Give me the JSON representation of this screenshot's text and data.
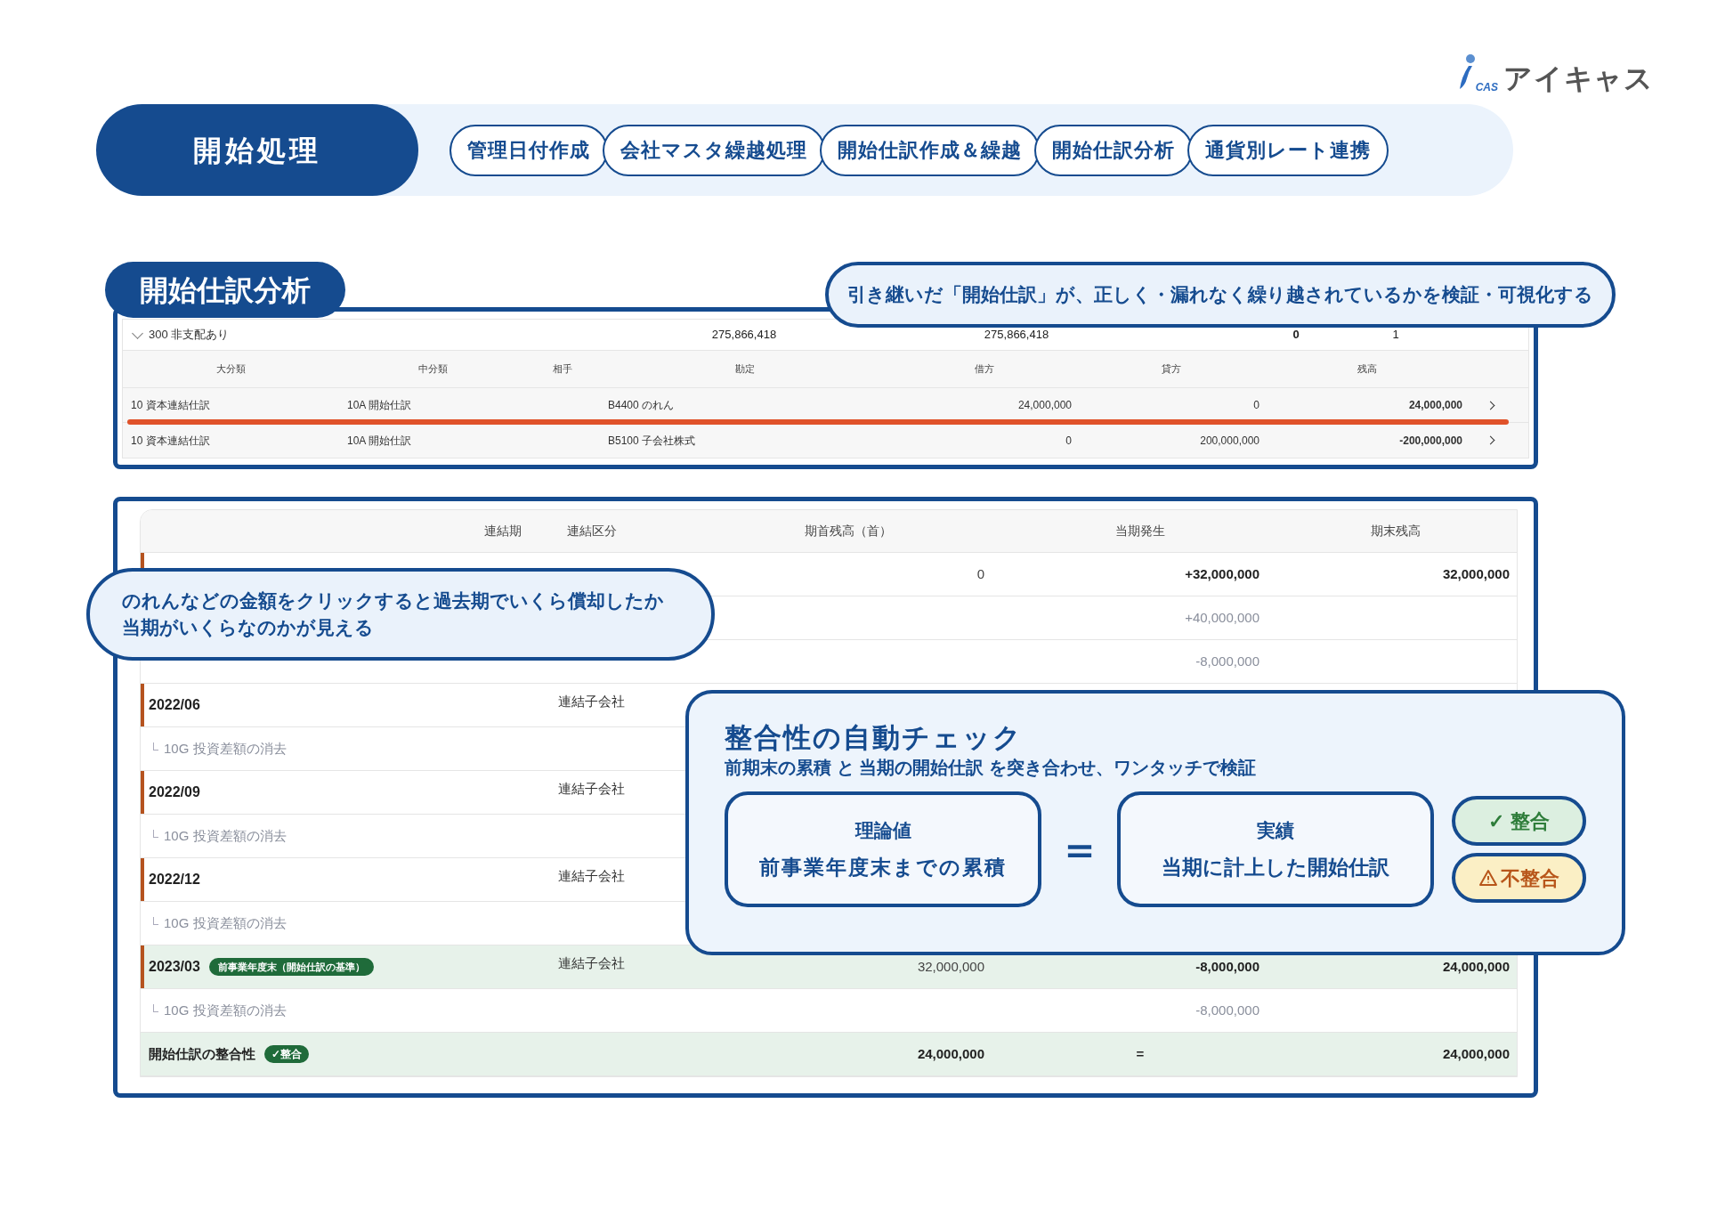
{
  "logo": {
    "mark": "CAS",
    "name": "アイキャス"
  },
  "header": {
    "title": "開始処理",
    "tabs": [
      {
        "label": "管理日付作成"
      },
      {
        "label": "会社マスタ繰越処理"
      },
      {
        "label": "開始仕訳作成＆繰越"
      },
      {
        "label": "開始仕訳分析"
      },
      {
        "label": "通貨別レート連携"
      }
    ]
  },
  "section_title": "開始仕訳分析",
  "top_callout": "引き継いだ「開始仕訳」が、正しく・漏れなく繰り越されているかを検証・可視化する",
  "journal_table": {
    "group": {
      "label": "300 非支配あり",
      "expanded": true,
      "values": [
        "275,866,418",
        "275,866,418",
        "0",
        "1"
      ]
    },
    "columns": [
      "大分類",
      "中分類",
      "相手",
      "勘定",
      "借方",
      "貸方",
      "残高"
    ],
    "rows": [
      {
        "major": "10 資本連結仕訳",
        "minor": "10A 開始仕訳",
        "account": "B4400 のれん",
        "debit": "24,000,000",
        "credit": "0",
        "balance": "24,000,000",
        "underlined": true
      },
      {
        "major": "10 資本連結仕訳",
        "minor": "10A 開始仕訳",
        "account": "B5100 子会社株式",
        "debit": "0",
        "credit": "200,000,000",
        "balance": "-200,000,000",
        "underlined": false
      }
    ]
  },
  "period_table": {
    "columns": [
      "連結期",
      "連結区分",
      "期首残高（首）",
      "当期発生",
      "期末残高"
    ],
    "rows": [
      {
        "kind": "period",
        "highlighted": false,
        "opening": "0",
        "change": "+32,000,000",
        "closing": "32,000,000"
      },
      {
        "kind": "entry",
        "highlighted": false,
        "change": "+40,000,000"
      },
      {
        "kind": "entry",
        "highlighted": false,
        "change": "-8,000,000"
      },
      {
        "kind": "period",
        "highlighted": false,
        "period": "2022/06",
        "segment": "連結子会社"
      },
      {
        "kind": "entry",
        "highlighted": false,
        "label": "10G 投資差額の消去"
      },
      {
        "kind": "period",
        "highlighted": false,
        "period": "2022/09",
        "segment": "連結子会社"
      },
      {
        "kind": "entry",
        "highlighted": false,
        "label": "10G 投資差額の消去"
      },
      {
        "kind": "period",
        "highlighted": false,
        "period": "2022/12",
        "segment": "連結子会社"
      },
      {
        "kind": "entry",
        "highlighted": false,
        "label": "10G 投資差額の消去"
      },
      {
        "kind": "period",
        "highlighted": true,
        "period": "2023/03",
        "tag": "前事業年度末（開始仕訳の基準）",
        "segment": "連結子会社",
        "opening": "32,000,000",
        "change": "-8,000,000",
        "closing": "24,000,000"
      },
      {
        "kind": "entry",
        "highlighted": false,
        "label": "10G 投資差額の消去",
        "change": "-8,000,000"
      },
      {
        "kind": "total",
        "highlighted": true,
        "label": "開始仕訳の整合性",
        "tag": "✓整合",
        "opening": "24,000,000",
        "change": "=",
        "closing": "24,000,000"
      }
    ]
  },
  "left_callout": [
    "のれんなどの金額をクリックすると過去期でいくら償却したか",
    "当期がいくらなのかが見える"
  ],
  "check_callout": {
    "title": "整合性の自動チェック",
    "subtitle": "前期末の累積 と 当期の開始仕訳 を突き合わせ、ワンタッチで検証",
    "left_box": {
      "title": "理論値",
      "text": "前事業年度末までの累積"
    },
    "operator": "＝",
    "right_box": {
      "title": "実績",
      "text": "当期に計上した開始仕訳"
    },
    "results": [
      {
        "kind": "ok",
        "label": "✓ 整合"
      },
      {
        "kind": "ng",
        "label": "不整合"
      }
    ]
  }
}
